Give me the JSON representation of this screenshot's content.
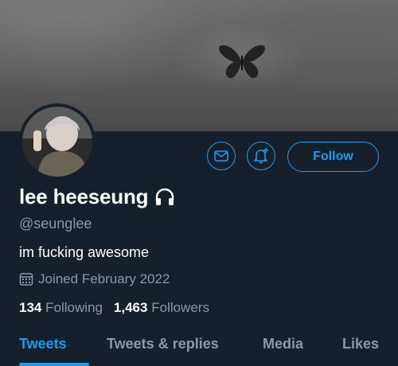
{
  "profile": {
    "display_name": "lee heeseung",
    "handle": "@seunglee",
    "bio": "im fucking awesome",
    "joined": "Joined February 2022",
    "following_count": "134",
    "following_label": "Following",
    "followers_count": "1,463",
    "followers_label": "Followers"
  },
  "actions": {
    "follow_label": "Follow"
  },
  "tabs": [
    {
      "label": "Tweets",
      "active": true
    },
    {
      "label": "Tweets & replies",
      "active": false
    },
    {
      "label": "Media",
      "active": false
    },
    {
      "label": "Likes",
      "active": false
    }
  ],
  "icons": {
    "message": "envelope-icon",
    "notify": "bell-plus-icon",
    "name_badge": "headphones-icon",
    "joined": "calendar-icon"
  },
  "colors": {
    "background": "#15202b",
    "accent": "#1d9bf0",
    "secondary_text": "#8899a6"
  }
}
